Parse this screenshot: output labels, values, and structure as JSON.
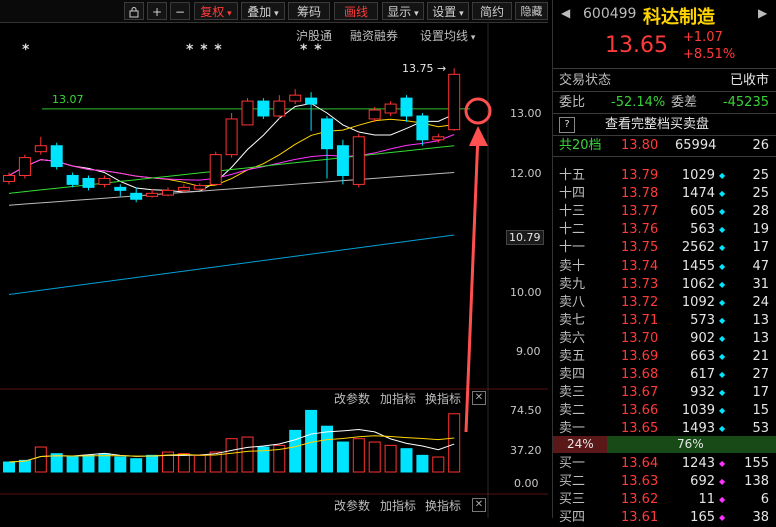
{
  "toolbar": {
    "lock_icon": "lock-icon",
    "plus": "+",
    "minus": "−",
    "fuquan": "复权",
    "diejia": "叠加",
    "chouma": "筹码",
    "huaxian": "画线",
    "xianshi": "显示",
    "shezhi": "设置",
    "jianyue": "简约",
    "yincang": "隐藏",
    "arrows": "▶▶"
  },
  "chart_labels": {
    "hugutong": "沪股通",
    "rongzi": "融资融券",
    "shezhi_junxian": "设置均线",
    "gaijiacan1": "改参数",
    "jiazhibiao1": "加指标",
    "huanzhibiao1": "换指标",
    "gaijiacan2": "改参数",
    "jiazhibiao2": "加指标",
    "huanzhibiao2": "换指标",
    "line_1307": "13.07",
    "high_label": "13.75 →",
    "stars": "* * *",
    "star_left": "*",
    "stars_mid": "* *"
  },
  "chart_data": {
    "type": "candlestick",
    "price_axis": [
      "13.00",
      "12.00",
      "10.79",
      "10.00",
      "9.00"
    ],
    "volume_axis": [
      "74.50",
      "37.20",
      "0.00"
    ],
    "reference_line": 13.07,
    "high_label": 13.75,
    "candles": [
      {
        "o": 11.85,
        "c": 11.95,
        "h": 12.0,
        "l": 11.8
      },
      {
        "o": 11.95,
        "c": 12.25,
        "h": 12.3,
        "l": 11.9
      },
      {
        "o": 12.35,
        "c": 12.45,
        "h": 12.6,
        "l": 12.3
      },
      {
        "o": 12.45,
        "c": 12.1,
        "h": 12.5,
        "l": 12.05
      },
      {
        "o": 11.95,
        "c": 11.8,
        "h": 12.0,
        "l": 11.75
      },
      {
        "o": 11.9,
        "c": 11.75,
        "h": 11.95,
        "l": 11.7
      },
      {
        "o": 11.8,
        "c": 11.9,
        "h": 11.95,
        "l": 11.75
      },
      {
        "o": 11.75,
        "c": 11.7,
        "h": 11.8,
        "l": 11.6
      },
      {
        "o": 11.65,
        "c": 11.55,
        "h": 11.75,
        "l": 11.5
      },
      {
        "o": 11.6,
        "c": 11.65,
        "h": 11.72,
        "l": 11.58
      },
      {
        "o": 11.62,
        "c": 11.7,
        "h": 11.75,
        "l": 11.6
      },
      {
        "o": 11.7,
        "c": 11.75,
        "h": 11.8,
        "l": 11.65
      },
      {
        "o": 11.72,
        "c": 11.78,
        "h": 11.82,
        "l": 11.7
      },
      {
        "o": 11.8,
        "c": 12.3,
        "h": 12.35,
        "l": 11.78
      },
      {
        "o": 12.3,
        "c": 12.9,
        "h": 13.0,
        "l": 12.25
      },
      {
        "o": 12.8,
        "c": 13.2,
        "h": 13.25,
        "l": 12.8
      },
      {
        "o": 13.2,
        "c": 12.95,
        "h": 13.25,
        "l": 12.9
      },
      {
        "o": 12.95,
        "c": 13.2,
        "h": 13.3,
        "l": 12.9
      },
      {
        "o": 13.2,
        "c": 13.3,
        "h": 13.4,
        "l": 13.15
      },
      {
        "o": 13.25,
        "c": 13.15,
        "h": 13.35,
        "l": 12.7
      },
      {
        "o": 12.9,
        "c": 12.4,
        "h": 12.95,
        "l": 11.9
      },
      {
        "o": 12.45,
        "c": 11.95,
        "h": 12.55,
        "l": 11.8
      },
      {
        "o": 11.8,
        "c": 12.6,
        "h": 12.65,
        "l": 11.75
      },
      {
        "o": 12.9,
        "c": 13.05,
        "h": 13.1,
        "l": 12.85
      },
      {
        "o": 13.0,
        "c": 13.15,
        "h": 13.2,
        "l": 12.95
      },
      {
        "o": 13.25,
        "c": 12.95,
        "h": 13.3,
        "l": 12.85
      },
      {
        "o": 12.95,
        "c": 12.55,
        "h": 13.0,
        "l": 12.45
      },
      {
        "o": 12.55,
        "c": 12.6,
        "h": 12.65,
        "l": 12.5
      },
      {
        "o": 12.72,
        "c": 13.65,
        "h": 13.75,
        "l": 12.7
      }
    ],
    "volumes": [
      {
        "v": 12,
        "up": false
      },
      {
        "v": 14,
        "up": false
      },
      {
        "v": 30,
        "up": true
      },
      {
        "v": 22,
        "up": false
      },
      {
        "v": 18,
        "up": false
      },
      {
        "v": 20,
        "up": false
      },
      {
        "v": 22,
        "up": false
      },
      {
        "v": 18,
        "up": false
      },
      {
        "v": 16,
        "up": false
      },
      {
        "v": 20,
        "up": false
      },
      {
        "v": 24,
        "up": true
      },
      {
        "v": 22,
        "up": true
      },
      {
        "v": 20,
        "up": true
      },
      {
        "v": 24,
        "up": true
      },
      {
        "v": 40,
        "up": true
      },
      {
        "v": 42,
        "up": true
      },
      {
        "v": 30,
        "up": false
      },
      {
        "v": 32,
        "up": true
      },
      {
        "v": 50,
        "up": false
      },
      {
        "v": 74,
        "up": false
      },
      {
        "v": 55,
        "up": false
      },
      {
        "v": 36,
        "up": false
      },
      {
        "v": 40,
        "up": true
      },
      {
        "v": 36,
        "up": true
      },
      {
        "v": 32,
        "up": true
      },
      {
        "v": 28,
        "up": false
      },
      {
        "v": 20,
        "up": false
      },
      {
        "v": 18,
        "up": true
      },
      {
        "v": 70,
        "up": true
      }
    ]
  },
  "quote": {
    "code": "600499",
    "name": "科达制造",
    "price": "13.65",
    "change": "+1.07",
    "change_pct": "+8.51%",
    "status_label": "交易状态",
    "status_value": "已收市",
    "weibi_label": "委比",
    "weibi_value": "-52.14%",
    "weicha_label": "委差",
    "weicha_value": "-45235",
    "full_book": "查看完整档买卖盘",
    "total_label": "共20档",
    "total_price": "13.80",
    "total_vol": "65994",
    "total_cnt": "26",
    "sell_rows": [
      {
        "label": "十五",
        "price": "13.79",
        "vol": "1029",
        "cnt": "25"
      },
      {
        "label": "十四",
        "price": "13.78",
        "vol": "1474",
        "cnt": "25"
      },
      {
        "label": "十三",
        "price": "13.77",
        "vol": "605",
        "cnt": "28"
      },
      {
        "label": "十二",
        "price": "13.76",
        "vol": "563",
        "cnt": "19"
      },
      {
        "label": "十一",
        "price": "13.75",
        "vol": "2562",
        "cnt": "17"
      },
      {
        "label": "卖十",
        "price": "13.74",
        "vol": "1455",
        "cnt": "47"
      },
      {
        "label": "卖九",
        "price": "13.73",
        "vol": "1062",
        "cnt": "31"
      },
      {
        "label": "卖八",
        "price": "13.72",
        "vol": "1092",
        "cnt": "24"
      },
      {
        "label": "卖七",
        "price": "13.71",
        "vol": "573",
        "cnt": "13"
      },
      {
        "label": "卖六",
        "price": "13.70",
        "vol": "902",
        "cnt": "13"
      },
      {
        "label": "卖五",
        "price": "13.69",
        "vol": "663",
        "cnt": "21"
      },
      {
        "label": "卖四",
        "price": "13.68",
        "vol": "617",
        "cnt": "27"
      },
      {
        "label": "卖三",
        "price": "13.67",
        "vol": "932",
        "cnt": "17"
      },
      {
        "label": "卖二",
        "price": "13.66",
        "vol": "1039",
        "cnt": "15"
      },
      {
        "label": "卖一",
        "price": "13.65",
        "vol": "1493",
        "cnt": "53"
      }
    ],
    "ratio_left": "24%",
    "ratio_right": "76%",
    "buy_rows": [
      {
        "label": "买一",
        "price": "13.64",
        "vol": "1243",
        "cnt": "155"
      },
      {
        "label": "买二",
        "price": "13.63",
        "vol": "692",
        "cnt": "138"
      },
      {
        "label": "买三",
        "price": "13.62",
        "vol": "11",
        "cnt": "6"
      },
      {
        "label": "买四",
        "price": "13.61",
        "vol": "165",
        "cnt": "38"
      }
    ]
  },
  "colors": {
    "up": "#ff3333",
    "down": "#00e5ff",
    "ma5": "#ffffff",
    "ma10": "#ffd400",
    "ma20": "#ff33ff",
    "ma30": "#33dd33",
    "ma60": "#bbbbbb",
    "ma120": "#00a0d8",
    "annotation": "#ff5050"
  }
}
